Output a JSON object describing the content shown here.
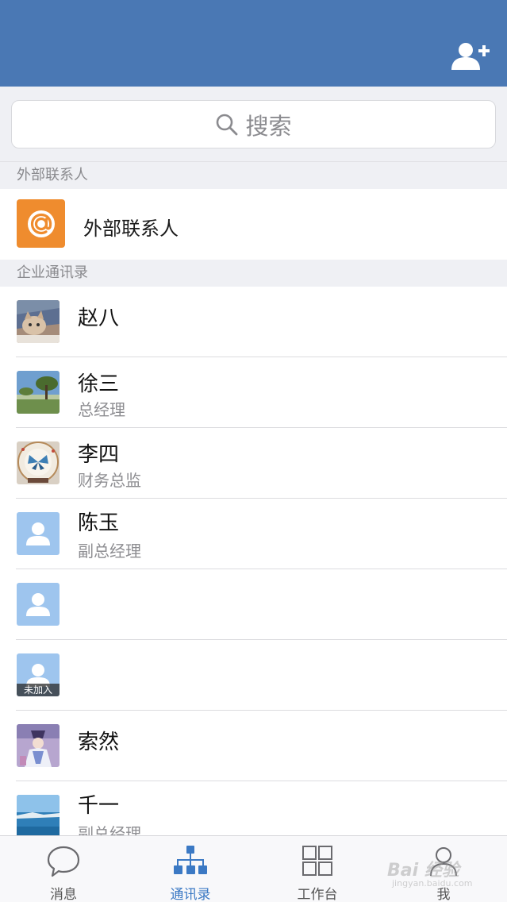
{
  "header": {
    "add_contact_icon": "add-contact-icon",
    "background_color": "#4a78b4"
  },
  "search": {
    "placeholder": "搜索",
    "icon": "search-icon"
  },
  "sections": {
    "external": "外部联系人",
    "enterprise": "企业通讯录"
  },
  "external_contact": {
    "label": "外部联系人",
    "icon": "at-sign-icon",
    "icon_color": "#ef8c2e"
  },
  "contacts": [
    {
      "name": "赵八",
      "title": "",
      "avatar": "cat-photo"
    },
    {
      "name": "徐三",
      "title": "总经理",
      "avatar": "tree-landscape-photo"
    },
    {
      "name": "李四",
      "title": "财务总监",
      "avatar": "butterfly-plate-photo"
    },
    {
      "name": "陈玉",
      "title": "副总经理",
      "avatar": "default-person-icon"
    },
    {
      "name": "",
      "title": "",
      "avatar": "default-person-icon"
    },
    {
      "name": "",
      "title": "",
      "avatar": "default-person-icon",
      "badge": "未加入"
    },
    {
      "name": "索然",
      "title": "",
      "avatar": "anime-character-photo"
    },
    {
      "name": "千一",
      "title": "副总经理",
      "avatar": "sea-coast-photo"
    }
  ],
  "tabbar": {
    "active": "contacts",
    "active_color": "#3b79c4",
    "tabs": [
      {
        "label": "消息",
        "icon": "chat-bubble-icon"
      },
      {
        "label": "通讯录",
        "icon": "org-chart-icon"
      },
      {
        "label": "工作台",
        "icon": "grid-apps-icon"
      },
      {
        "label": "我",
        "icon": "person-icon"
      }
    ]
  },
  "watermark": {
    "text": "Bai 经验",
    "sub": "jingyan.baidu.com"
  }
}
